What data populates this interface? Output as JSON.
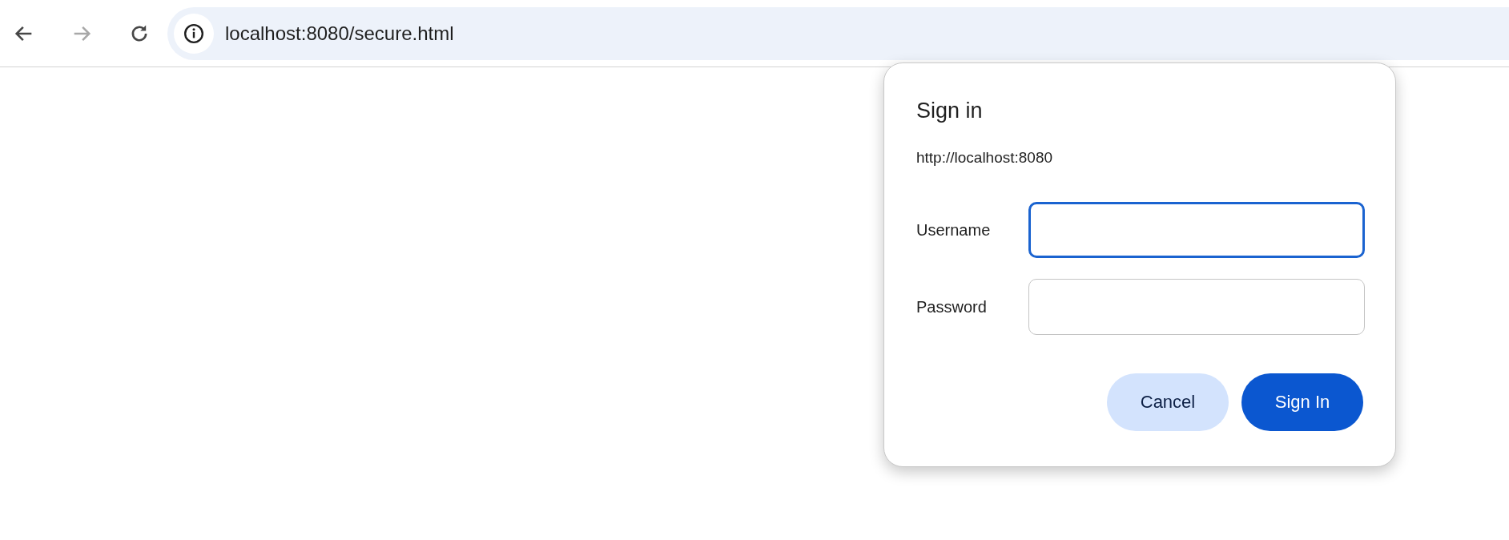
{
  "toolbar": {
    "nav_buttons": [
      {
        "kind": "back",
        "disabled": false
      },
      {
        "kind": "forward",
        "disabled": true
      },
      {
        "kind": "reload",
        "disabled": false
      }
    ],
    "address": "localhost:8080/secure.html"
  },
  "dialog": {
    "title": "Sign in",
    "origin": "http://localhost:8080",
    "fields": [
      {
        "label": "Username",
        "focused": true
      },
      {
        "label": "Password",
        "focused": false
      }
    ],
    "buttons": [
      {
        "label": "Cancel",
        "kind": "secondary"
      },
      {
        "label": "Sign In",
        "kind": "primary"
      }
    ]
  }
}
